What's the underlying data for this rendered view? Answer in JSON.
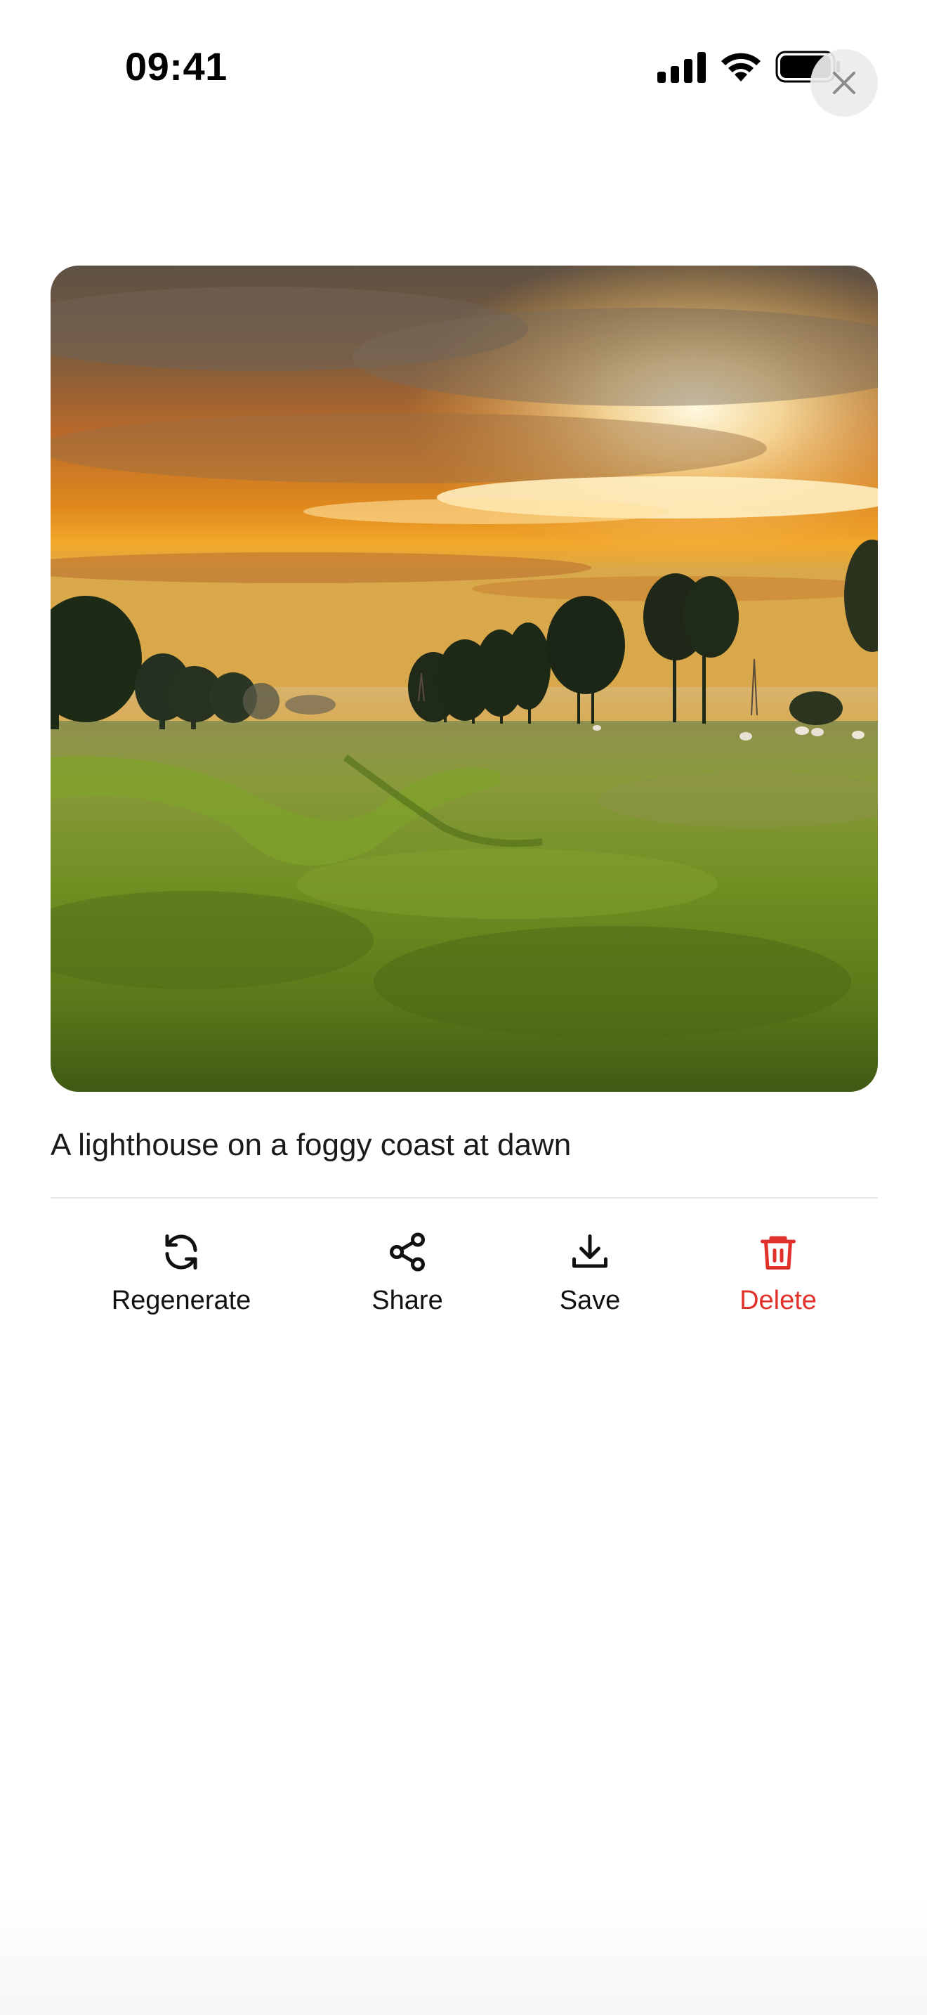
{
  "status_bar": {
    "time": "09:41",
    "icons": [
      "cellular-signal-icon",
      "wifi-icon",
      "battery-icon"
    ]
  },
  "close_button": {
    "icon": "close-icon"
  },
  "image": {
    "subject": "generated-image"
  },
  "prompt": "A lighthouse on a foggy coast at dawn",
  "actions": [
    {
      "label": "Regenerate",
      "icon": "refresh-icon"
    },
    {
      "label": "Share",
      "icon": "share-icon"
    },
    {
      "label": "Save",
      "icon": "download-icon"
    },
    {
      "label": "Delete",
      "icon": "trash-icon",
      "color": "#e0312b"
    }
  ],
  "colors": {
    "danger": "#e0312b",
    "text": "#111111",
    "divider": "#e8e8e8"
  }
}
